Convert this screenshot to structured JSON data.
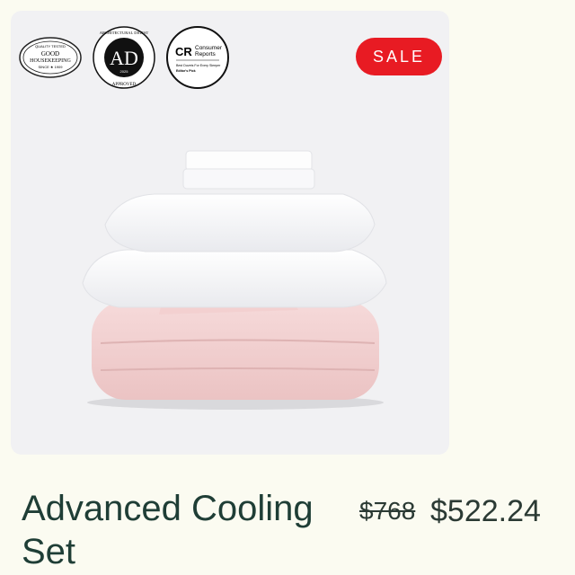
{
  "badges": {
    "gh": {
      "top": "QUALITY TESTED",
      "main1": "GOOD",
      "main2": "HOUSEKEEPING",
      "bottom": "SINCE ★ 1909"
    },
    "ad": {
      "ring": "ARCHITECTURAL DIGEST",
      "letters": "AD",
      "year": "2025",
      "approved": "APPROVED"
    },
    "cr": {
      "mark": "CR",
      "name1": "Consumer",
      "name2": "Reports",
      "line1": "Best Duvets For Every Sleeper",
      "line2": "Editor's Pick"
    }
  },
  "sale_label": "SALE",
  "product": {
    "title": "Advanced Cooling Set",
    "price_original": "$768",
    "price_sale": "$522.24"
  },
  "colors": {
    "sale_badge": "#e81b23",
    "title": "#1f3e36",
    "duvet": "#f2d3d3",
    "pillow": "#ffffff"
  },
  "icons": [
    "good-housekeeping-seal-icon",
    "architectural-digest-approved-icon",
    "consumer-reports-icon"
  ]
}
